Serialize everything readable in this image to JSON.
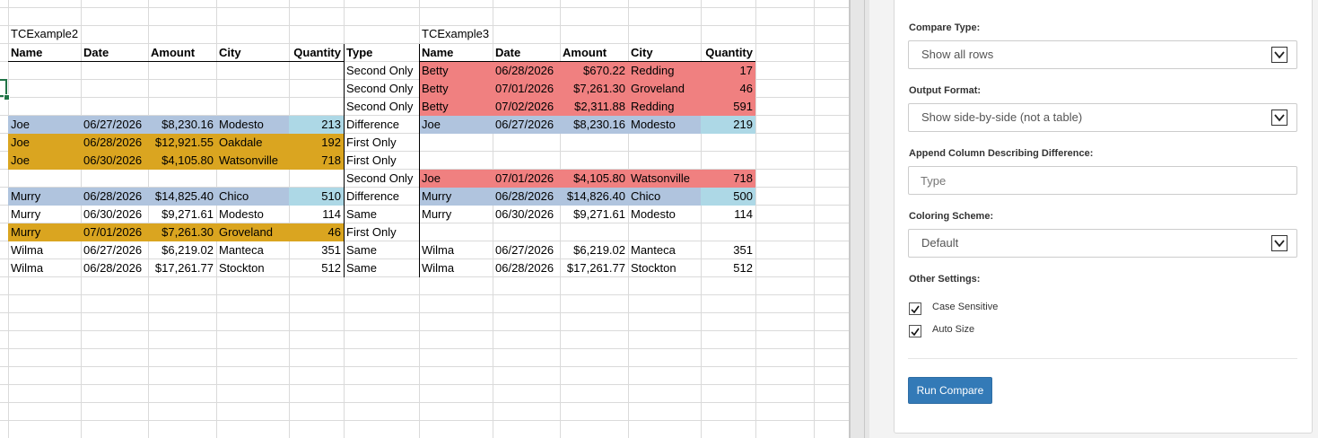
{
  "sheet": {
    "left_table_title": "TCExample2",
    "right_table_title": "TCExample3",
    "left_headers": [
      "Name",
      "Date",
      "Amount",
      "City",
      "Quantity",
      "Type"
    ],
    "right_headers": [
      "Name",
      "Date",
      "Amount",
      "City",
      "Quantity"
    ],
    "rows": [
      {
        "left": [
          "",
          "",
          "",
          "",
          ""
        ],
        "type": "Second Only",
        "right": [
          "Betty",
          "06/28/2026",
          "$670.22",
          "Redding",
          "17"
        ]
      },
      {
        "left": [
          "",
          "",
          "",
          "",
          ""
        ],
        "type": "Second Only",
        "right": [
          "Betty",
          "07/01/2026",
          "$7,261.30",
          "Groveland",
          "46"
        ]
      },
      {
        "left": [
          "",
          "",
          "",
          "",
          ""
        ],
        "type": "Second Only",
        "right": [
          "Betty",
          "07/02/2026",
          "$2,311.88",
          "Redding",
          "591"
        ]
      },
      {
        "left": [
          "Joe",
          "06/27/2026",
          "$8,230.16",
          "Modesto",
          "213"
        ],
        "type": "Difference",
        "right": [
          "Joe",
          "06/27/2026",
          "$8,230.16",
          "Modesto",
          "219"
        ]
      },
      {
        "left": [
          "Joe",
          "06/28/2026",
          "$12,921.55",
          "Oakdale",
          "192"
        ],
        "type": "First Only",
        "right": [
          "",
          "",
          "",
          "",
          ""
        ]
      },
      {
        "left": [
          "Joe",
          "06/30/2026",
          "$4,105.80",
          "Watsonville",
          "718"
        ],
        "type": "First Only",
        "right": [
          "",
          "",
          "",
          "",
          ""
        ]
      },
      {
        "left": [
          "",
          "",
          "",
          "",
          ""
        ],
        "type": "Second Only",
        "right": [
          "Joe",
          "07/01/2026",
          "$4,105.80",
          "Watsonville",
          "718"
        ]
      },
      {
        "left": [
          "Murry",
          "06/28/2026",
          "$14,825.40",
          "Chico",
          "510"
        ],
        "type": "Difference",
        "right": [
          "Murry",
          "06/28/2026",
          "$14,826.40",
          "Chico",
          "500"
        ]
      },
      {
        "left": [
          "Murry",
          "06/30/2026",
          "$9,271.61",
          "Modesto",
          "114"
        ],
        "type": "Same",
        "right": [
          "Murry",
          "06/30/2026",
          "$9,271.61",
          "Modesto",
          "114"
        ]
      },
      {
        "left": [
          "Murry",
          "07/01/2026",
          "$7,261.30",
          "Groveland",
          "46"
        ],
        "type": "First Only",
        "right": [
          "",
          "",
          "",
          "",
          ""
        ]
      },
      {
        "left": [
          "Wilma",
          "06/27/2026",
          "$6,219.02",
          "Manteca",
          "351"
        ],
        "type": "Same",
        "right": [
          "Wilma",
          "06/27/2026",
          "$6,219.02",
          "Manteca",
          "351"
        ]
      },
      {
        "left": [
          "Wilma",
          "06/28/2026",
          "$17,261.77",
          "Stockton",
          "512"
        ],
        "type": "Same",
        "right": [
          "Wilma",
          "06/28/2026",
          "$17,261.77",
          "Stockton",
          "512"
        ]
      }
    ]
  },
  "colors": {
    "second_only": "#f08080",
    "first_only": "#daa520",
    "difference_row": "#b0c4de",
    "difference_cell": "#add8e6",
    "button": "#337ab7"
  },
  "panel": {
    "compare_type_label": "Compare Type:",
    "compare_type_value": "Show all rows",
    "output_format_label": "Output Format:",
    "output_format_value": "Show side-by-side (not a table)",
    "append_column_label": "Append Column Describing Difference:",
    "append_column_placeholder": "Type",
    "coloring_label": "Coloring Scheme:",
    "coloring_value": "Default",
    "other_settings_label": "Other Settings:",
    "case_sensitive_label": "Case Sensitive",
    "auto_size_label": "Auto Size",
    "run_button_label": "Run Compare",
    "dropdown_icon": "chevron-down-icon",
    "check_icon": "checkmark-icon"
  }
}
